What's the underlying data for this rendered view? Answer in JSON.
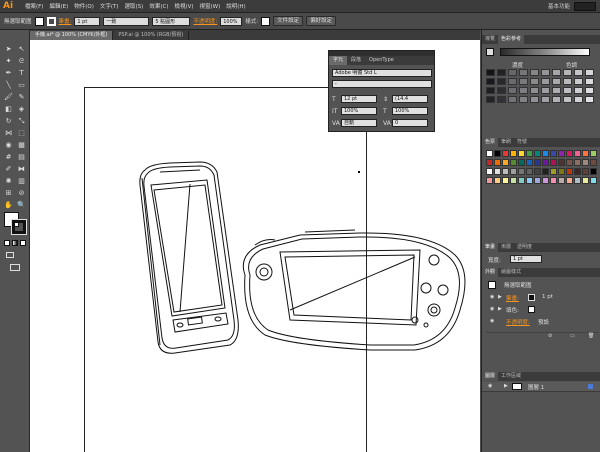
{
  "app": {
    "logo": "Ai",
    "workspace": "基本功能"
  },
  "menu": [
    "檔案(F)",
    "編輯(E)",
    "物件(O)",
    "文字(T)",
    "選取(S)",
    "效果(C)",
    "檢視(V)",
    "視窗(W)",
    "說明(H)"
  ],
  "control": {
    "selection": "無選取範圍",
    "stroke_label": "筆畫:",
    "stroke_value": "1 pt",
    "line_style": "一致",
    "brush": "5 點圓形",
    "opacity_label": "不透明度:",
    "opacity_value": "100%",
    "style_label": "樣式:",
    "doc_setup": "文件設定",
    "preferences": "偏好設定"
  },
  "tabs": [
    {
      "label": "手機.ai* @ 100% (CMYK/外框)",
      "active": true
    },
    {
      "label": "PSP.ai @ 100% (RGB/預視)",
      "active": false
    }
  ],
  "character_panel": {
    "tabs": [
      "字元",
      "段落",
      "OpenType"
    ],
    "font": "Adobe 明體 Std L",
    "style": "-",
    "size": "12 pt",
    "leading": "(14.4",
    "hscale": "100%",
    "vscale": "100%",
    "kerning": "自動",
    "tracking": "0"
  },
  "right_panel": {
    "top_tabs": [
      "導覽",
      "色彩參考"
    ],
    "shades_label": "濃度",
    "colors_label": "色調",
    "swatch_tabs": [
      "色票",
      "筆刷",
      "符號"
    ],
    "stroke_tabs": [
      "筆畫",
      "漸層",
      "透明度"
    ],
    "weight_label": "寬度:",
    "weight_value": "1 pt",
    "appearance_tabs": [
      "外觀",
      "繪圖樣式"
    ],
    "appearance_title": "無選取範圍",
    "app_stroke": "筆畫:",
    "app_stroke_val": "1 pt",
    "app_fill": "填色:",
    "app_opacity": "不透明度:",
    "app_opacity_val": "預設",
    "layers_tabs": [
      "圖層",
      "工作區域"
    ],
    "layer_name": "圖層 1"
  },
  "colors": {
    "accent": "#f7941d",
    "ui_dark": "#3c3c3c",
    "panel": "#535353",
    "canvas": "#ffffff"
  }
}
